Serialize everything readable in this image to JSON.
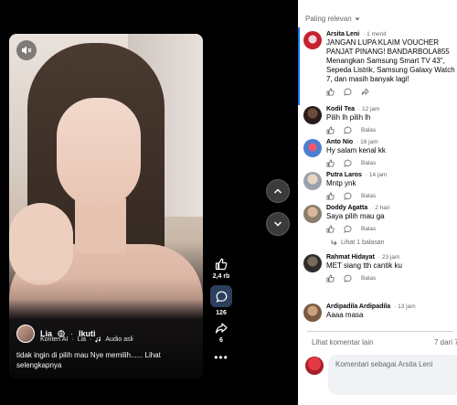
{
  "viewer": {
    "author": {
      "name": "Lia",
      "follow_label": "Ikuti",
      "separator": "·"
    },
    "meta": {
      "label_ai": "Konten AI",
      "author_short": "Lia",
      "audio": "Audio asli"
    },
    "caption": "tidak ingin di pilih mau Nye memilih...... Lihat selengkapnya",
    "likes": "2,4 rb",
    "comments": "126",
    "shares": "6"
  },
  "comments_panel": {
    "sort_label": "Paling relevan",
    "reply_label": "Balas",
    "items": [
      {
        "name": "Arsita Leni",
        "time": "· 1 menit",
        "text": "JANGAN LUPA KLAIM VOUCHER PANJAT PINANG! BANDARBOLA855 Menangkan Samsung Smart TV 43\", Sepeda Listrik, Samsung Galaxy Watch 7, dan masih banyak lagi!",
        "avatar_color": "#c4222f"
      },
      {
        "name": "Kodil Tea",
        "time": "· 12 jam",
        "text": "Pilih lh pilih lh",
        "avatar_color": "#3a2a2a"
      },
      {
        "name": "Anto Nio",
        "time": "· 16 jam",
        "text": "Hy salam kenal kk",
        "avatar_color": "#4a7fd1"
      },
      {
        "name": "Putra Laros",
        "time": "· 14 jam",
        "text": "Mntp ynk",
        "avatar_color": "#9aa3ad"
      },
      {
        "name": "Doddy Agatta",
        "time": "· 2 hari",
        "text": "Saya pilih mau ga",
        "avatar_color": "#8c7d6c"
      },
      {
        "name": "Rahmat Hidayat",
        "time": "· 23 jam",
        "text": "MET siang tth cantik ku",
        "avatar_color": "#2d2d2d"
      },
      {
        "name": "Ardipadila Ardipadila",
        "time": "· 13 jam",
        "text": "Aaaa masa",
        "avatar_color": "#7a5a40"
      }
    ],
    "view_replies": "Lihat 1 balasan",
    "more_comments": "Lihat komentar lain",
    "count": "7 dari 7",
    "write_placeholder": "Komentari sebagai Arsita Leni"
  }
}
